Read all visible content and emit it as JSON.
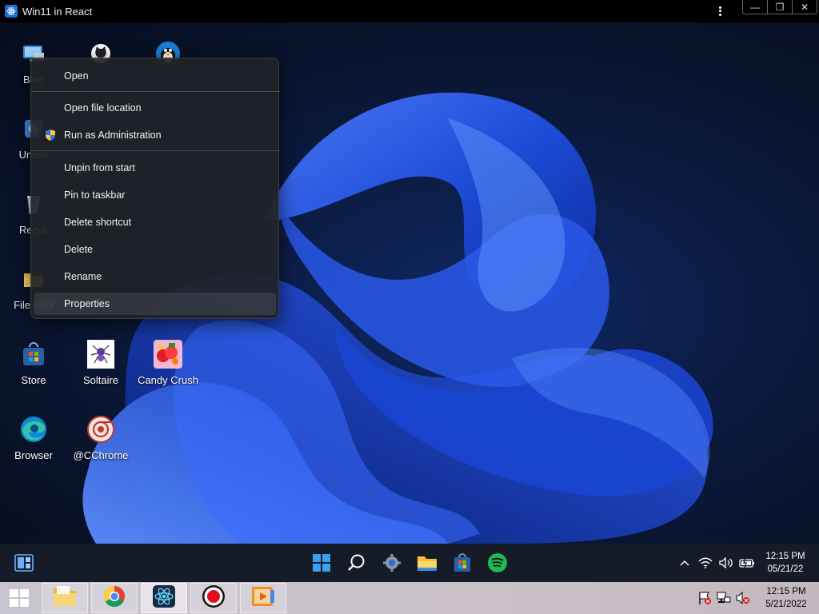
{
  "window": {
    "title": "Win11 in React",
    "icon": "react-icon",
    "controls": {
      "minimize": "—",
      "maximize": "❐",
      "close": "✕"
    }
  },
  "desktop": {
    "icons": [
      {
        "name": "blue-pc-icon",
        "label": "Blue"
      },
      {
        "name": "github-icon",
        "label": ""
      },
      {
        "name": "linux-icon",
        "label": ""
      },
      {
        "name": "unescape-icon",
        "label": "Unesc"
      },
      {
        "name": "recycle-bin-icon",
        "label": "Recyc"
      },
      {
        "name": "file-explorer-icon",
        "label": "File Expl"
      },
      {
        "name": "store-icon",
        "label": "Store"
      },
      {
        "name": "solitaire-icon",
        "label": "Soltaire"
      },
      {
        "name": "candy-crush-icon",
        "label": "Candy Crush"
      },
      {
        "name": "edge-browser-icon",
        "label": "Browser"
      },
      {
        "name": "chrome-icon",
        "label": "@CChrome"
      }
    ]
  },
  "context_menu": {
    "items": [
      {
        "label": "Open"
      },
      {
        "label": "Open file location"
      },
      {
        "label": "Run as Administration",
        "icon": "shield-icon"
      },
      {
        "label": "Unpin from start"
      },
      {
        "label": "Pin to taskbar"
      },
      {
        "label": "Delete shortcut"
      },
      {
        "label": "Delete"
      },
      {
        "label": "Rename"
      },
      {
        "label": "Properties"
      }
    ]
  },
  "inner_taskbar": {
    "widgets_icon": "widgets-icon",
    "apps": [
      "windows-start-icon",
      "search-icon",
      "settings-gear-icon",
      "file-explorer-icon",
      "store-icon",
      "spotify-icon"
    ],
    "tray": [
      "chevron-up-icon",
      "wifi-icon",
      "volume-icon",
      "battery-icon"
    ],
    "clock": {
      "time": "12:15 PM",
      "date": "05/21/22"
    }
  },
  "host_taskbar": {
    "start_icon": "windows-start-icon",
    "apps": [
      "file-explorer-icon",
      "chrome-icon",
      "react-icon",
      "record-icon",
      "media-player-icon"
    ],
    "tray": [
      "flag-alert-icon",
      "network-icon",
      "muted-volume-icon"
    ],
    "clock": {
      "time": "12:15 PM",
      "date": "5/21/2022"
    }
  },
  "colors": {
    "wallpaper_dark": "#081228",
    "bloom_blue": "#1f4fe0",
    "menu_bg": "#202228",
    "spotify_green": "#1db954",
    "accent": "#1d6fd6"
  }
}
